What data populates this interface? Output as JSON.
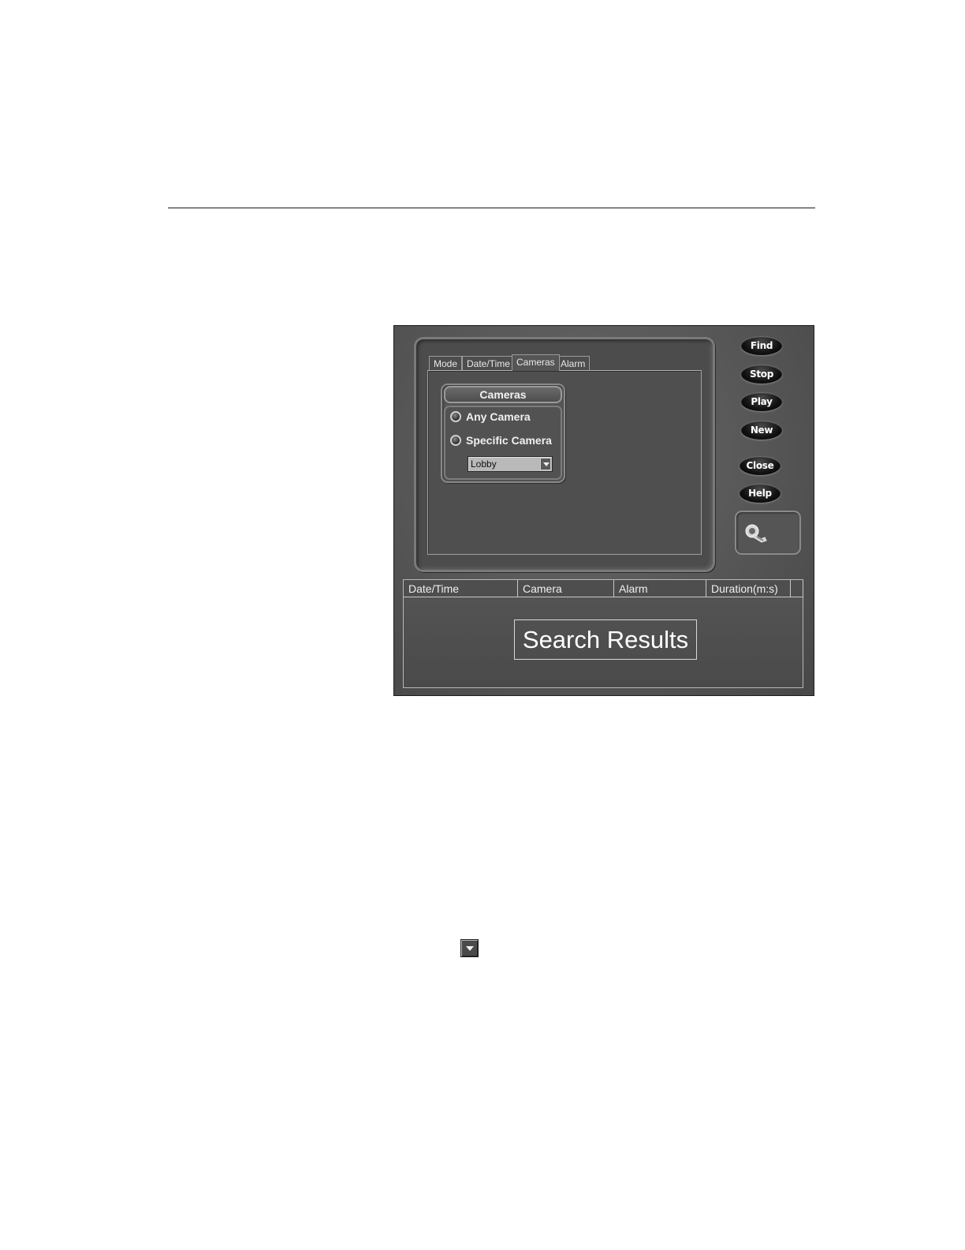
{
  "search_window": {
    "tabs": [
      {
        "label": "Mode"
      },
      {
        "label": "Date/Time"
      },
      {
        "label": "Cameras"
      },
      {
        "label": "Alarm"
      }
    ],
    "active_tab": "Cameras",
    "cameras_group": {
      "title": "Cameras",
      "options": [
        {
          "label": "Any Camera"
        },
        {
          "label": "Specific Camera"
        }
      ],
      "camera_select": {
        "value": "Lobby"
      }
    },
    "buttons": {
      "find": "Find",
      "stop": "Stop",
      "play": "Play",
      "new": "New",
      "close": "Close",
      "help": "Help"
    },
    "logo_icon": "camera-icon",
    "results": {
      "columns": [
        "Date/Time",
        "Camera",
        "Alarm",
        "Duration(m:s)"
      ],
      "placeholder": "Search Results"
    }
  },
  "inline_icon": "dropdown-arrow-icon"
}
